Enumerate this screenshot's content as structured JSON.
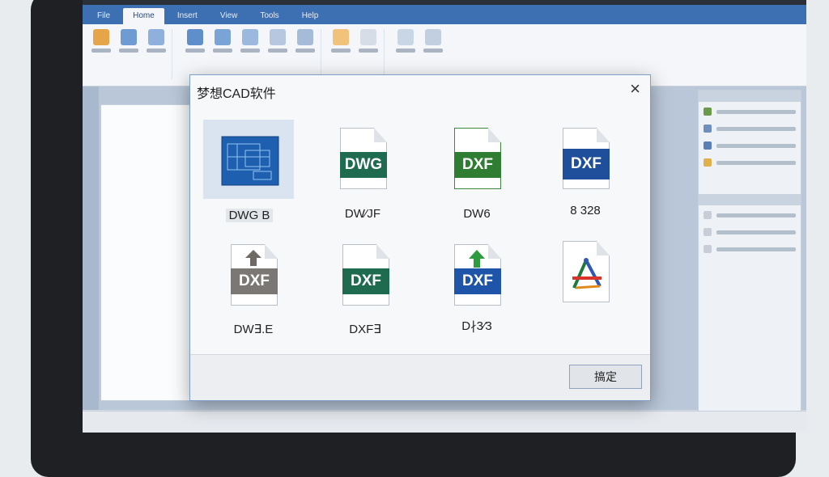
{
  "app": {
    "tabs": [
      "File",
      "Home",
      "Insert",
      "View",
      "Tools",
      "Help"
    ],
    "active_tab_index": 1
  },
  "dialog": {
    "title": "梦想CAD软件",
    "close_symbol": "×",
    "ok_button": "搞定",
    "items": [
      {
        "label": "DWG B",
        "icon": "blueprint-thumbnail",
        "selected": true
      },
      {
        "label": "DW⁄JF",
        "icon": "dwg-file-icon",
        "band_text": "DWG",
        "band_color": "#1e6b4f"
      },
      {
        "label": "DW6",
        "icon": "dxf-file-icon",
        "band_text": "DXF",
        "band_color": "#2e7d32"
      },
      {
        "label": "8 328",
        "icon": "dxf-file-icon",
        "band_text": "DXF",
        "band_color": "#1f4f9a"
      },
      {
        "label": "DW∃.E",
        "icon": "dxf-upload-file-icon",
        "band_text": "DXF",
        "band_color": "#7a7774"
      },
      {
        "label": "DXF∃",
        "icon": "dxf-file-icon",
        "band_text": "DXF",
        "band_color": "#1e6b4f"
      },
      {
        "label": "D∤3⁄3",
        "icon": "dxf-export-file-icon",
        "band_text": "DXF",
        "band_color": "#1f55a8"
      },
      {
        "label": "",
        "icon": "cad-3d-model-file-icon"
      }
    ]
  },
  "colors": {
    "ribbon_accent": "#3d6fb3",
    "selection_bg": "#d9e4f0"
  }
}
